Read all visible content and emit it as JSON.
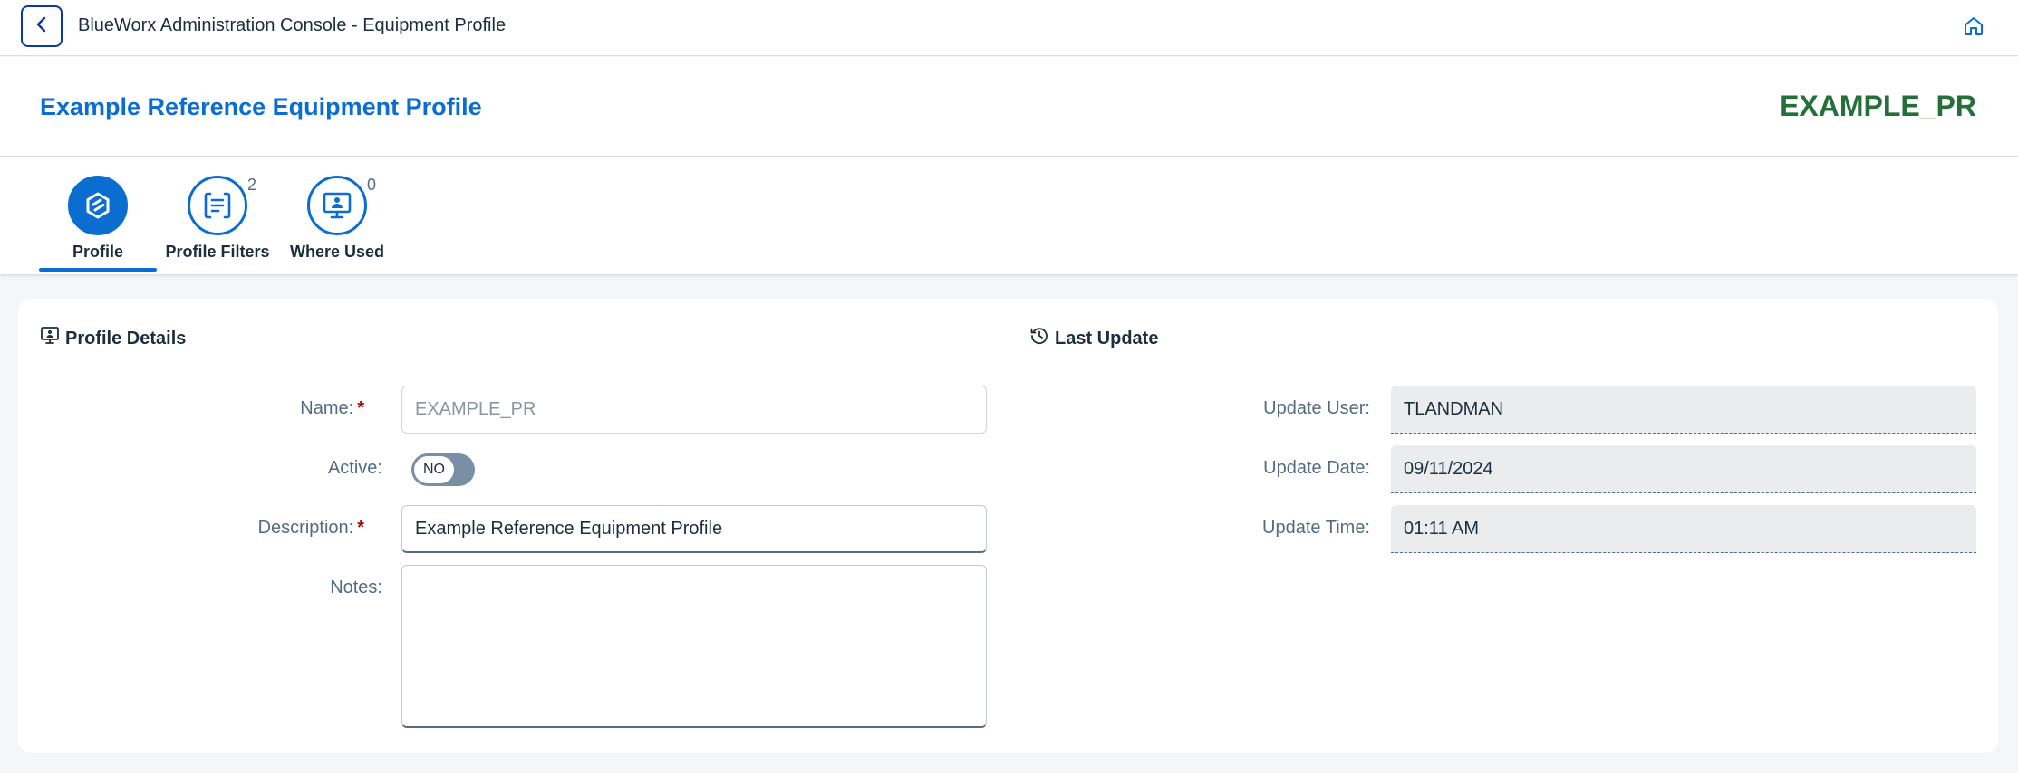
{
  "shell": {
    "title": "BlueWorx Administration Console - Equipment Profile"
  },
  "header": {
    "object_title": "Example Reference Equipment Profile",
    "object_id": "EXAMPLE_PR"
  },
  "tabs": [
    {
      "label": "Profile",
      "count": "",
      "icon": "profile-icon",
      "selected": true
    },
    {
      "label": "Profile Filters",
      "count": "2",
      "icon": "filter-list-icon",
      "selected": false
    },
    {
      "label": "Where Used",
      "count": "0",
      "icon": "monitor-icon",
      "selected": false
    }
  ],
  "profile_details": {
    "heading": "Profile Details",
    "name_label": "Name:",
    "name_value": "EXAMPLE_PR",
    "active_label": "Active:",
    "active_value": "NO",
    "description_label": "Description:",
    "description_value": "Example Reference Equipment Profile",
    "notes_label": "Notes:",
    "notes_value": ""
  },
  "last_update": {
    "heading": "Last Update",
    "user_label": "Update User:",
    "user_value": "TLANDMAN",
    "date_label": "Update Date:",
    "date_value": "09/11/2024",
    "time_label": "Update Time:",
    "time_value": "01:11 AM"
  },
  "colors": {
    "accent": "#0a6ed1",
    "id_green": "#256f3a",
    "required": "#aa0808"
  }
}
